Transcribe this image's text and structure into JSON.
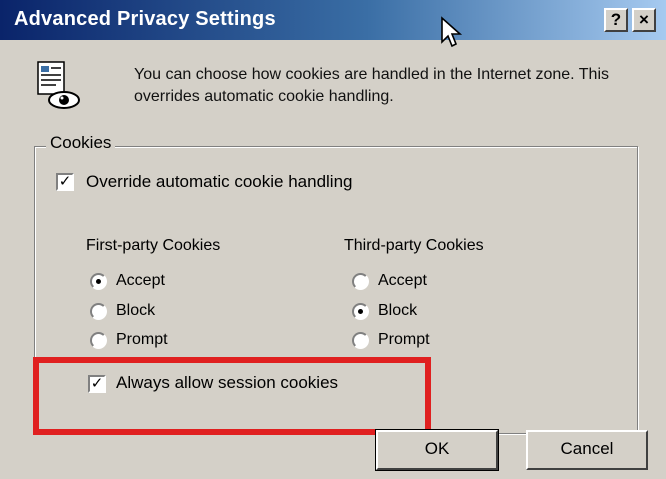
{
  "window": {
    "title": "Advanced Privacy Settings",
    "help_button": "?",
    "close_button": "×"
  },
  "intro": {
    "text": "You can choose how cookies are handled in the Internet zone.  This overrides automatic cookie handling."
  },
  "cookies_group": {
    "label": "Cookies",
    "override_label": "Override automatic cookie handling",
    "override_checked": true,
    "first_party": {
      "heading": "First-party Cookies",
      "options": [
        "Accept",
        "Block",
        "Prompt"
      ],
      "selected": "Accept"
    },
    "third_party": {
      "heading": "Third-party Cookies",
      "options": [
        "Accept",
        "Block",
        "Prompt"
      ],
      "selected": "Block"
    },
    "session_label": "Always allow session cookies",
    "session_checked": true
  },
  "buttons": {
    "ok": "OK",
    "cancel": "Cancel"
  },
  "colors": {
    "title_gradient_start": "#0a246a",
    "dialog_face": "#d4d0c8",
    "highlight": "#e02020"
  },
  "icons": [
    "privacy-document-eye-icon",
    "mouse-cursor-icon"
  ]
}
